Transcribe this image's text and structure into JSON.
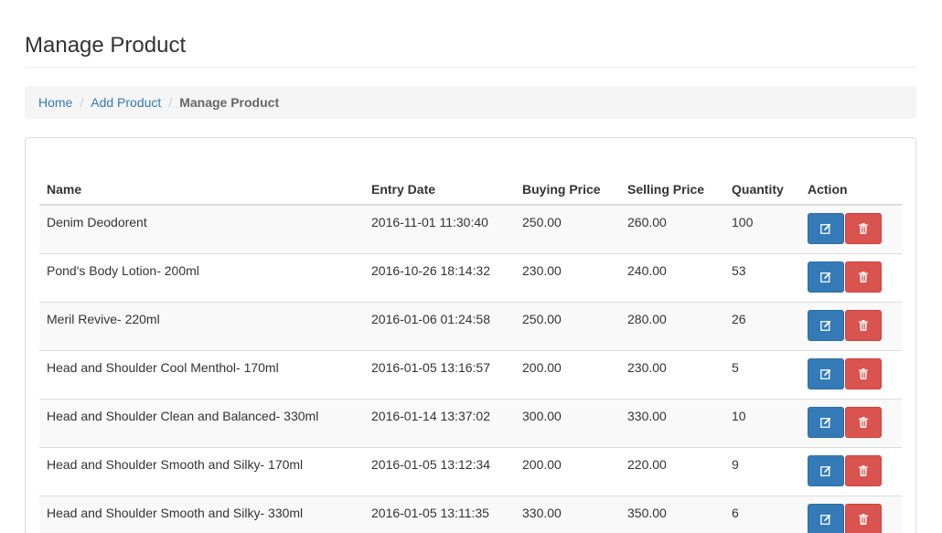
{
  "page": {
    "title": "Manage Product"
  },
  "breadcrumb": {
    "home": "Home",
    "add_product": "Add Product",
    "current": "Manage Product",
    "separator": "/"
  },
  "table": {
    "headers": {
      "name": "Name",
      "entry_date": "Entry Date",
      "buying_price": "Buying Price",
      "selling_price": "Selling Price",
      "quantity": "Quantity",
      "action": "Action"
    },
    "rows": [
      {
        "name": "Denim Deodorent",
        "entry_date": "2016-11-01 11:30:40",
        "buying_price": "250.00",
        "selling_price": "260.00",
        "quantity": "100"
      },
      {
        "name": "Pond's Body Lotion- 200ml",
        "entry_date": "2016-10-26 18:14:32",
        "buying_price": "230.00",
        "selling_price": "240.00",
        "quantity": "53"
      },
      {
        "name": "Meril Revive- 220ml",
        "entry_date": "2016-01-06 01:24:58",
        "buying_price": "250.00",
        "selling_price": "280.00",
        "quantity": "26"
      },
      {
        "name": "Head and Shoulder Cool Menthol- 170ml",
        "entry_date": "2016-01-05 13:16:57",
        "buying_price": "200.00",
        "selling_price": "230.00",
        "quantity": "5"
      },
      {
        "name": "Head and Shoulder Clean and Balanced- 330ml",
        "entry_date": "2016-01-14 13:37:02",
        "buying_price": "300.00",
        "selling_price": "330.00",
        "quantity": "10"
      },
      {
        "name": "Head and Shoulder Smooth and Silky- 170ml",
        "entry_date": "2016-01-05 13:12:34",
        "buying_price": "200.00",
        "selling_price": "220.00",
        "quantity": "9"
      },
      {
        "name": "Head and Shoulder Smooth and Silky- 330ml",
        "entry_date": "2016-01-05 13:11:35",
        "buying_price": "330.00",
        "selling_price": "350.00",
        "quantity": "6"
      }
    ]
  },
  "icons": {
    "edit": "edit-icon",
    "delete": "trash-icon"
  },
  "colors": {
    "edit_button": "#337ab7",
    "delete_button": "#d9534f",
    "link": "#337ab7"
  }
}
